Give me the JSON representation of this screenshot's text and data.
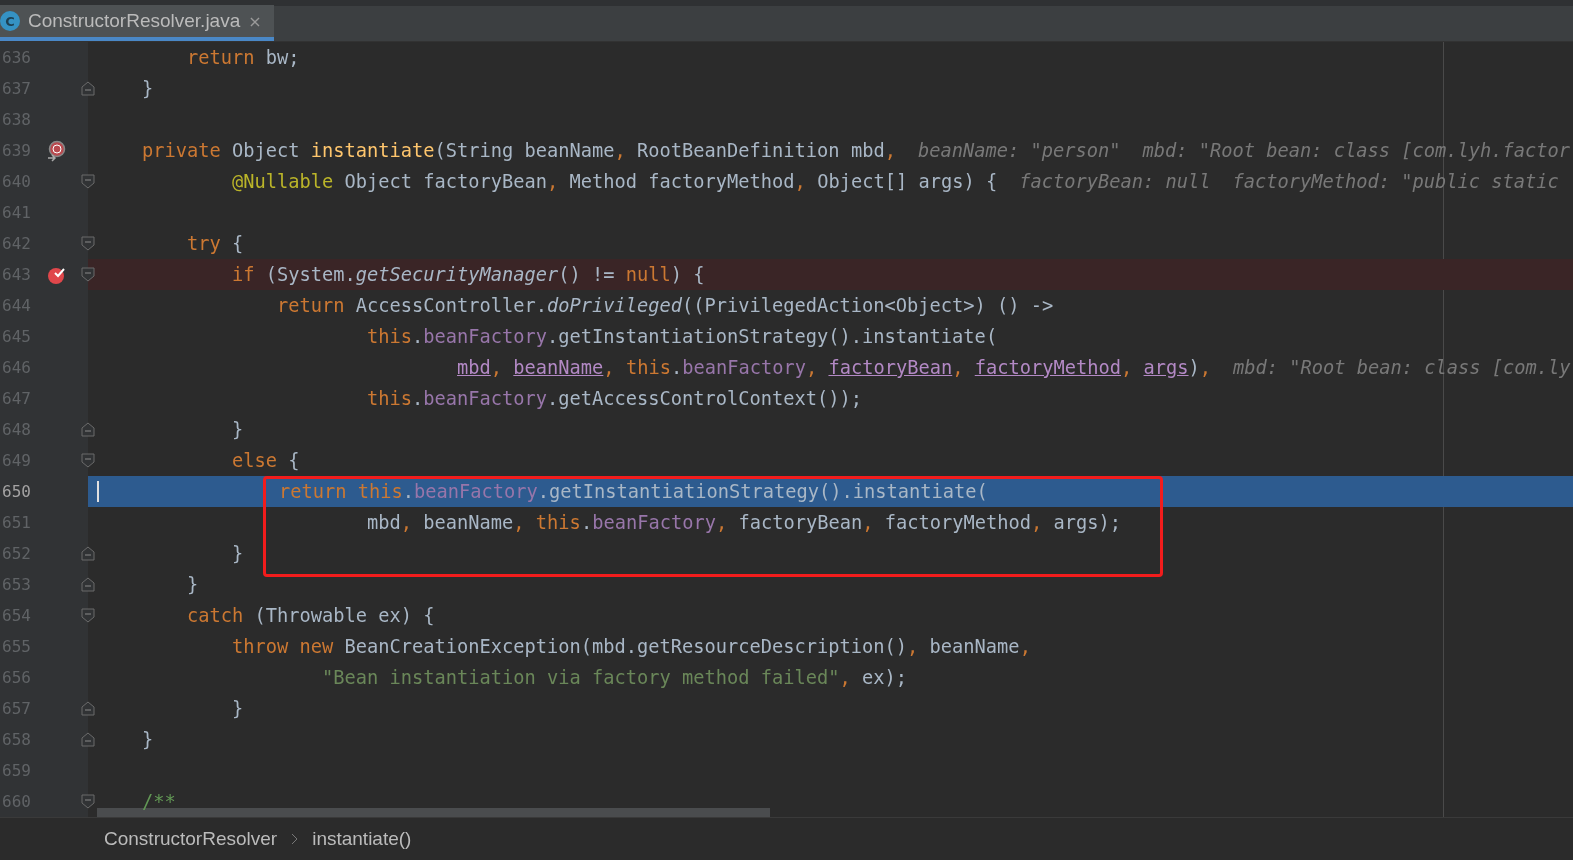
{
  "tab": {
    "icon_letter": "C",
    "label": "ConstructorResolver.java",
    "close": "×",
    "selected": true
  },
  "lines": [
    {
      "number": "636",
      "tokens": [
        {
          "text": "        return",
          "kind": "keyword"
        },
        {
          "text": " bw;",
          "kind": "plain"
        }
      ]
    },
    {
      "number": "637",
      "fold": {
        "kind": "end"
      },
      "tokens": [
        {
          "text": "    }",
          "kind": "plain"
        }
      ]
    },
    {
      "number": "638"
    },
    {
      "number": "639",
      "marker": {
        "kind": "method-breakpoint"
      },
      "tokens": [
        {
          "text": "    private",
          "kind": "keyword"
        },
        {
          "text": " Object ",
          "kind": "plain"
        },
        {
          "text": "instantiate",
          "kind": "declaration"
        },
        {
          "text": "(String beanName, RootBeanDefinition mbd,",
          "kind": "plain"
        }
      ],
      "hints": [
        "beanName: \"person\"",
        "mbd: \"Root bean: class [com.lyh.factor"
      ]
    },
    {
      "number": "640",
      "fold": {
        "kind": "start"
      },
      "tokens": [
        {
          "text": "            @Nullable",
          "kind": "annotation"
        },
        {
          "text": " Object factoryBean, Method factoryMethod, Object[] args) {",
          "kind": "plain"
        }
      ],
      "hints": [
        "factoryBean: null",
        "factoryMethod: \"public static"
      ]
    },
    {
      "number": "641"
    },
    {
      "number": "642",
      "fold": {
        "kind": "start"
      },
      "tokens": [
        {
          "text": "        try",
          "kind": "keyword"
        },
        {
          "text": " {",
          "kind": "plain"
        }
      ]
    },
    {
      "number": "643",
      "marker": {
        "kind": "breakpoint"
      },
      "fold": {
        "kind": "start"
      },
      "tokens": [
        {
          "text": "            if",
          "kind": "keyword"
        },
        {
          "text": " (System.",
          "kind": "plain"
        },
        {
          "text": "getSecurityManager",
          "kind": "static"
        },
        {
          "text": "() != ",
          "kind": "plain"
        },
        {
          "text": "null",
          "kind": "keyword"
        },
        {
          "text": ") {",
          "kind": "plain"
        }
      ]
    },
    {
      "number": "644",
      "tokens": [
        {
          "text": "                return",
          "kind": "keyword"
        },
        {
          "text": " AccessController.",
          "kind": "plain"
        },
        {
          "text": "doPrivileged",
          "kind": "static"
        },
        {
          "text": "((PrivilegedAction<Object>) () ->",
          "kind": "plain"
        }
      ]
    },
    {
      "number": "645",
      "tokens": [
        {
          "text": "                        this",
          "kind": "keyword"
        },
        {
          "text": ".beanFactory",
          "kind": "field"
        },
        {
          "text": ".getInstantiationStrategy().instantiate(",
          "kind": "plain"
        }
      ]
    },
    {
      "number": "646",
      "tokens": [
        {
          "text": "                                mbd",
          "kind": "param"
        },
        {
          "text": ", beanName",
          "kind": "param"
        },
        {
          "text": ", this",
          "kind": "keyword"
        },
        {
          "text": ".beanFactory",
          "kind": "field"
        },
        {
          "text": ", factoryBean",
          "kind": "param"
        },
        {
          "text": ", factoryMethod",
          "kind": "param"
        },
        {
          "text": ", args",
          "kind": "param"
        },
        {
          "text": "),",
          "kind": "plain"
        }
      ],
      "hints": [
        "mbd: \"Root bean: class [com.ly"
      ]
    },
    {
      "number": "647",
      "tokens": [
        {
          "text": "                        this",
          "kind": "keyword"
        },
        {
          "text": ".beanFactory",
          "kind": "field"
        },
        {
          "text": ".getAccessControlContext());",
          "kind": "plain"
        }
      ]
    },
    {
      "number": "648",
      "fold": {
        "kind": "end"
      },
      "tokens": [
        {
          "text": "            }",
          "kind": "plain"
        }
      ]
    },
    {
      "number": "649",
      "fold": {
        "kind": "start"
      },
      "tokens": [
        {
          "text": "            else",
          "kind": "keyword"
        },
        {
          "text": " {",
          "kind": "plain"
        }
      ]
    },
    {
      "number": "650",
      "selected": true,
      "tokens": [
        {
          "text": "                return this",
          "kind": "keyword"
        },
        {
          "text": ".beanFactory",
          "kind": "field"
        },
        {
          "text": ".getInstantiationStrategy().instantiate(",
          "kind": "plain"
        }
      ]
    },
    {
      "number": "651",
      "tokens": [
        {
          "text": "                        mbd, beanName",
          "kind": "plain"
        },
        {
          "text": ", this",
          "kind": "keyword"
        },
        {
          "text": ".beanFactory",
          "kind": "field"
        },
        {
          "text": ", factoryBean, factoryMethod, args);",
          "kind": "plain"
        }
      ]
    },
    {
      "number": "652",
      "fold": {
        "kind": "end"
      },
      "tokens": [
        {
          "text": "            }",
          "kind": "plain"
        }
      ]
    },
    {
      "number": "653",
      "fold": {
        "kind": "end"
      },
      "tokens": [
        {
          "text": "        }",
          "kind": "plain"
        }
      ]
    },
    {
      "number": "654",
      "fold": {
        "kind": "start"
      },
      "tokens": [
        {
          "text": "        catch",
          "kind": "keyword"
        },
        {
          "text": " (Throwable ex) {",
          "kind": "plain"
        }
      ]
    },
    {
      "number": "655",
      "tokens": [
        {
          "text": "            throw new",
          "kind": "keyword"
        },
        {
          "text": " BeanCreationException(mbd.getResourceDescription(), beanName,",
          "kind": "plain"
        }
      ]
    },
    {
      "number": "656",
      "tokens": [
        {
          "text": "                    \"Bean instantiation via factory method failed\"",
          "kind": "string"
        },
        {
          "text": ", ex);",
          "kind": "plain"
        }
      ]
    },
    {
      "number": "657",
      "fold": {
        "kind": "end"
      },
      "tokens": [
        {
          "text": "            }",
          "kind": "plain"
        }
      ]
    },
    {
      "number": "658",
      "fold": {
        "kind": "end"
      },
      "tokens": [
        {
          "text": "    }",
          "kind": "plain"
        }
      ]
    },
    {
      "number": "659"
    },
    {
      "number": "660",
      "fold": {
        "kind": "start"
      },
      "tokens": [
        {
          "text": "    /**",
          "kind": "comment"
        }
      ]
    }
  ],
  "breadcrumbs": [
    "ConstructorResolver",
    "instantiate()"
  ]
}
